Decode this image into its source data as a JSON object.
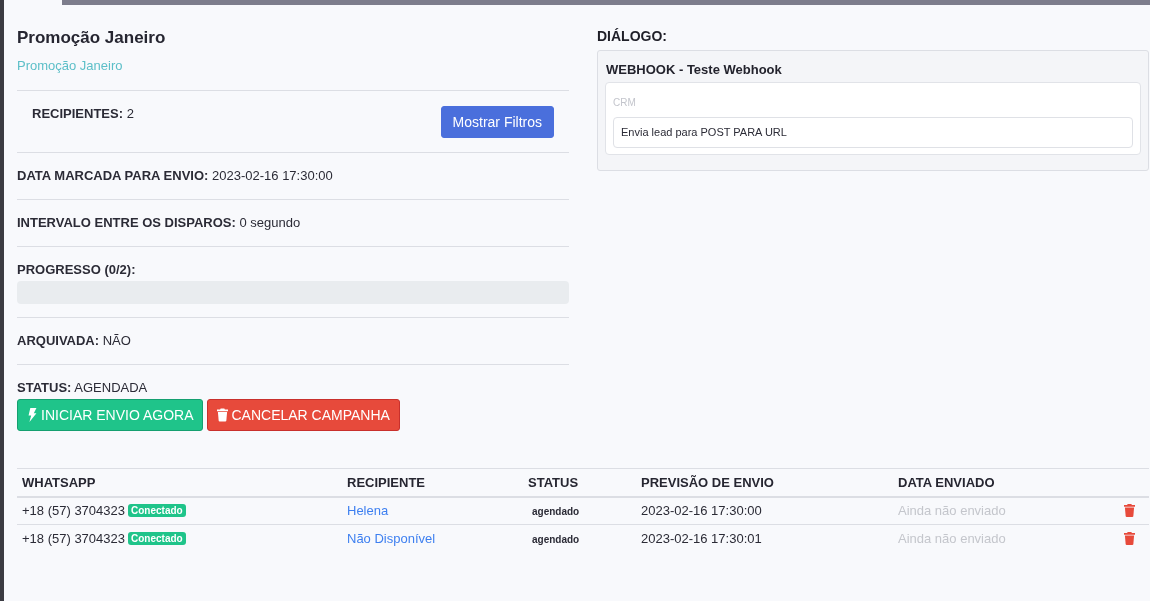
{
  "header": {
    "title": "Promoção Janeiro",
    "subtitle": "Promoção Janeiro"
  },
  "details": [
    {
      "kind": "recipients",
      "label": "RECIPIENTES:",
      "value": "2",
      "button": "Mostrar Filtros"
    },
    {
      "kind": "field",
      "label": "DATA MARCADA PARA ENVIO:",
      "value": "2023-02-16 17:30:00"
    },
    {
      "kind": "field",
      "label": "INTERVALO ENTRE OS DISPAROS:",
      "value": "0 segundo"
    },
    {
      "kind": "progress",
      "label": "PROGRESSO (0/2):",
      "level": 0
    },
    {
      "kind": "field",
      "label": "ARQUIVADA:",
      "value": "NÃO"
    },
    {
      "kind": "status",
      "label": "STATUS:",
      "value": "AGENDADA"
    }
  ],
  "actions": [
    {
      "kind": "start",
      "label": "INICIAR ENVIO AGORA"
    },
    {
      "kind": "cancel",
      "label": "CANCELAR CAMPANHA"
    }
  ],
  "dialog": {
    "heading": "DIÁLOGO:",
    "steps": [
      {
        "title": "WEBHOOK - Teste Webhook",
        "category": "CRM",
        "description": "Envia lead para POST PARA URL"
      }
    ]
  },
  "table": {
    "columns": [
      "WHATSAPP",
      "RECIPIENTE",
      "STATUS",
      "PREVISÃO DE ENVIO",
      "DATA ENVIADO"
    ],
    "rows": [
      {
        "whatsapp": "+18 (57) 3704323",
        "connection": "Conectado",
        "recipient": "Helena",
        "status": "agendado",
        "scheduled": "2023-02-16 17:30:00",
        "sent": "Ainda não enviado"
      },
      {
        "whatsapp": "+18 (57) 3704323",
        "connection": "Conectado",
        "recipient": "Não Disponível",
        "status": "agendado",
        "scheduled": "2023-02-16 17:30:01",
        "sent": "Ainda não enviado"
      }
    ]
  }
}
